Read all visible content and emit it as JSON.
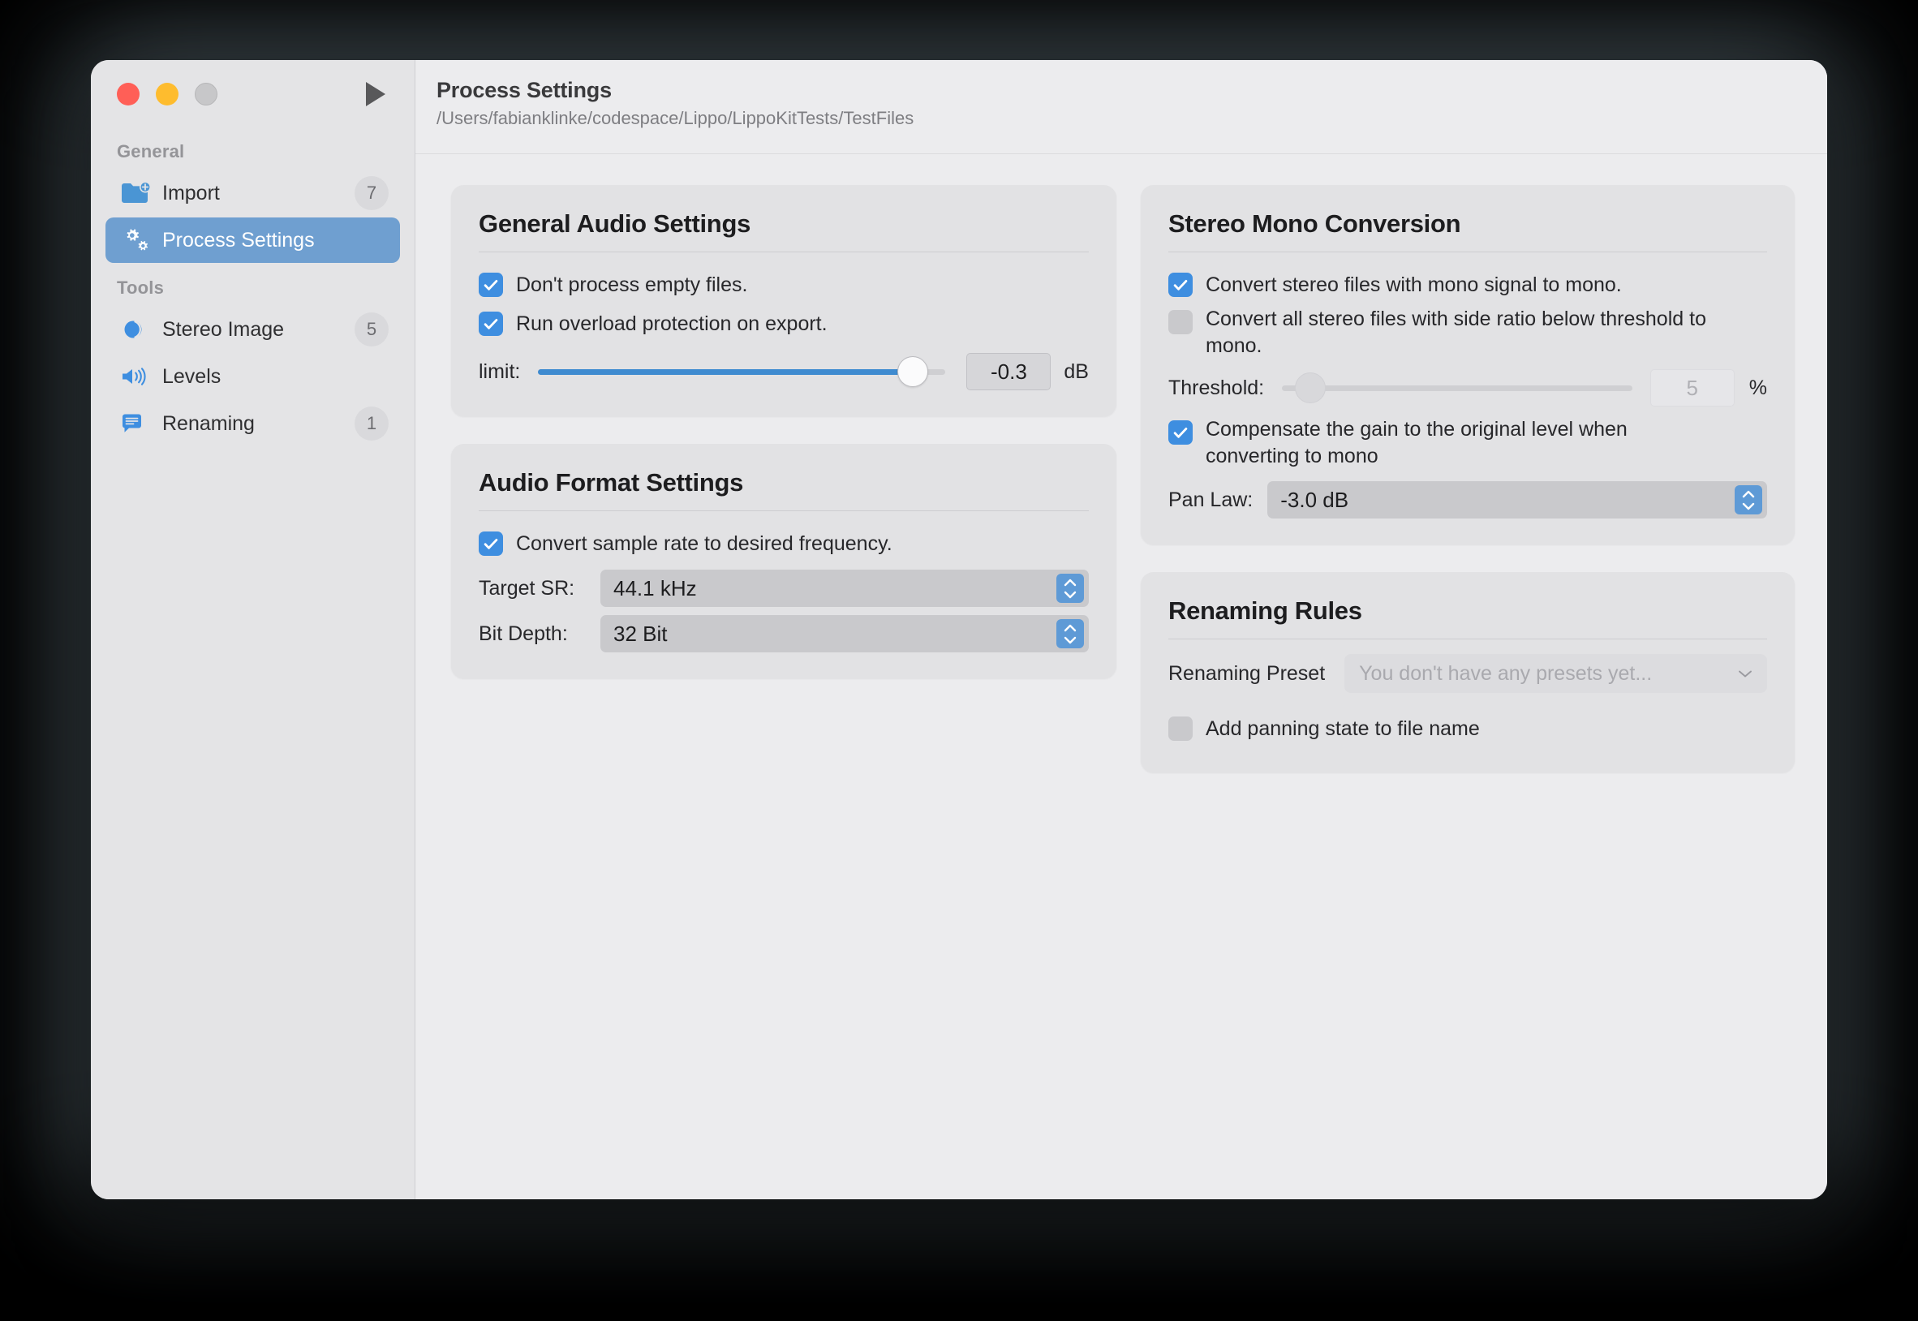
{
  "window": {
    "traffic_lights": [
      "close",
      "minimize",
      "zoom"
    ],
    "play_button": "run"
  },
  "sidebar": {
    "sections": [
      {
        "label": "General",
        "items": [
          {
            "icon": "folder-add-icon",
            "label": "Import",
            "badge": "7",
            "active": false
          },
          {
            "icon": "gears-icon",
            "label": "Process Settings",
            "badge": "",
            "active": true
          }
        ]
      },
      {
        "label": "Tools",
        "items": [
          {
            "icon": "stereo-image-icon",
            "label": "Stereo Image",
            "badge": "5",
            "active": false
          },
          {
            "icon": "speaker-icon",
            "label": "Levels",
            "badge": "",
            "active": false
          },
          {
            "icon": "rename-bubble-icon",
            "label": "Renaming",
            "badge": "1",
            "active": false
          }
        ]
      }
    ]
  },
  "header": {
    "title": "Process Settings",
    "path": "/Users/fabianklinke/codespace/Lippo/LippoKitTests/TestFiles"
  },
  "general_audio": {
    "title": "General Audio Settings",
    "empty_files": {
      "label": "Don't process empty files.",
      "checked": true
    },
    "overload": {
      "label": "Run overload protection on export.",
      "checked": true
    },
    "limit": {
      "label": "limit:",
      "value": "-0.3",
      "unit": "dB",
      "percent": 92
    }
  },
  "audio_format": {
    "title": "Audio Format Settings",
    "convert_sr": {
      "label": "Convert sample rate to desired frequency.",
      "checked": true
    },
    "target_sr": {
      "label": "Target SR:",
      "value": "44.1 kHz"
    },
    "bit_depth": {
      "label": "Bit Depth:",
      "value": "32 Bit"
    }
  },
  "stereo_mono": {
    "title": "Stereo Mono Conversion",
    "mono_signal": {
      "label": "Convert stereo files with mono signal to mono.",
      "checked": true
    },
    "side_ratio": {
      "label": "Convert all stereo files with side ratio below threshold to mono.",
      "checked": false
    },
    "threshold": {
      "label": "Threshold:",
      "value": "5",
      "unit": "%",
      "percent": 6,
      "disabled": true
    },
    "compensate": {
      "label": "Compensate the gain to the original level when converting to mono",
      "checked": true
    },
    "pan_law": {
      "label": "Pan Law:",
      "value": "-3.0 dB"
    }
  },
  "renaming": {
    "title": "Renaming Rules",
    "preset": {
      "label": "Renaming Preset",
      "value": "You don't have any presets yet..."
    },
    "add_panning": {
      "label": "Add panning state to file name",
      "checked": false
    }
  },
  "colors": {
    "accent": "#3e8ee0",
    "sidebar_selected": "#6f9fd0",
    "slider_fill": "#3f8bd0",
    "card_bg": "#e2e2e4",
    "content_bg": "#ececee"
  }
}
